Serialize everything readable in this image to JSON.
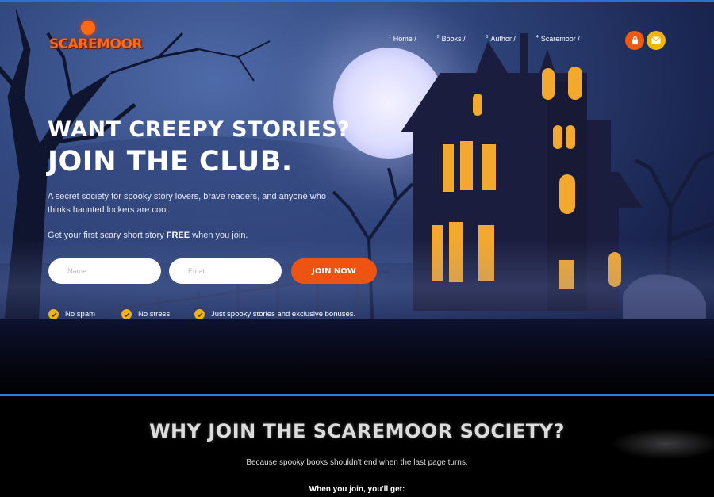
{
  "header": {
    "logo_text": "SCAREMOOR",
    "nav": [
      {
        "num": "1",
        "label": "Home /"
      },
      {
        "num": "2",
        "label": "Books /"
      },
      {
        "num": "3",
        "label": "Author /"
      },
      {
        "num": "4",
        "label": "Scaremoor /"
      }
    ],
    "icons": [
      "shopping-bag-icon",
      "envelope-icon"
    ]
  },
  "hero": {
    "title_line1": "WANT CREEPY STORIES?",
    "title_line2": "JOIN THE CLUB.",
    "description": "A secret society for spooky story lovers, brave readers, and anyone who thinks haunted lockers are cool.",
    "offer_prefix": "Get your first scary short story ",
    "offer_bold": "FREE",
    "offer_suffix": " when you join.",
    "form": {
      "name_placeholder": "Name",
      "email_placeholder": "Email",
      "submit_label": "JOIN NOW"
    },
    "perks": [
      "No spam",
      "No stress",
      "Just spooky stories and exclusive bonuses."
    ]
  },
  "why": {
    "title": "WHY JOIN THE SCAREMOOR SOCIETY?",
    "subtitle": "Because spooky books shouldn't end when the last page turns.",
    "get_heading": "When you join, you'll get:"
  },
  "colors": {
    "accent_orange": "#ee5411",
    "accent_yellow": "#f3b21a",
    "divider_blue": "#2e7bd8"
  }
}
